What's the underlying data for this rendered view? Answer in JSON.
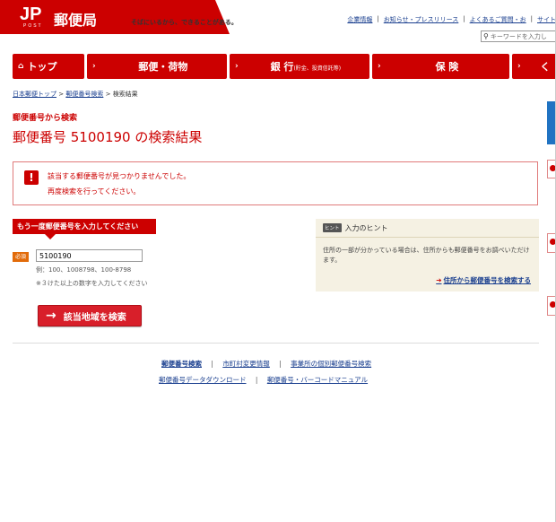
{
  "header": {
    "logo_jp": "JP",
    "logo_post": "POST",
    "brand": "郵便局",
    "tagline": "そばにいるから、できることがある。",
    "util_links": [
      "企業情報",
      "お知らせ・プレスリリース",
      "よくあるご質問・お",
      "サイト"
    ],
    "search_placeholder": "キーワードを入力し"
  },
  "nav": {
    "items": [
      {
        "label": "トップ",
        "icon": "home-icon"
      },
      {
        "label": "郵便・荷物"
      },
      {
        "label": "銀 行",
        "sub": "(貯金、投資信託等)"
      },
      {
        "label": "保 険"
      },
      {
        "label": "く"
      }
    ]
  },
  "breadcrumb": [
    "日本郵便トップ",
    "郵便番号検索",
    "検索結果"
  ],
  "section_label": "郵便番号から検索",
  "page_title": "郵便番号 5100190 の検索結果",
  "error": {
    "line1": "該当する郵便番号が見つかりませんでした。",
    "line2": "再度検索を行ってください。"
  },
  "form": {
    "heading": "もう一度郵便番号を入力してください",
    "required_label": "必須",
    "zip_value": "5100190",
    "example": "例：100、1008798、100-8798",
    "note": "※３けた以上の数字を入力してください",
    "submit_label": "該当地域を検索"
  },
  "hint": {
    "badge": "ヒント",
    "title": "入力のヒント",
    "body": "住所の一部が分かっている場合は、住所からも郵便番号をお調べいただけます。",
    "link_label": "住所から郵便番号を検索する"
  },
  "footer": {
    "row1": [
      "郵便番号検索",
      "市町村変更情報",
      "事業所の個別郵便番号検索"
    ],
    "row2": [
      "郵便番号データダウンロード",
      "郵便番号・バーコードマニュアル"
    ]
  },
  "colors": {
    "brand_red": "#cc0000",
    "link_blue": "#1a3f8f",
    "hint_bg": "#f5f1e3",
    "side_blue": "#2073c2"
  }
}
